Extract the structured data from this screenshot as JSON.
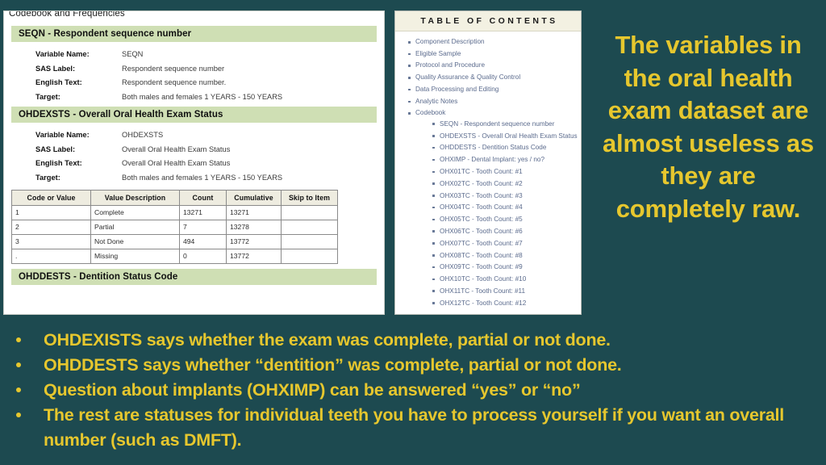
{
  "slide": {
    "background_color": "#1d4a50",
    "accent_color": "#e6c72e"
  },
  "headline": {
    "text": "The variables in the oral health exam dataset are almost useless as they are completely raw."
  },
  "screenshot": {
    "codebook_panel": {
      "title": "Codebook and Frequencies",
      "section_header_color": "#cfdfb4",
      "variables": [
        {
          "header": "SEQN - Respondent sequence number",
          "fields": [
            {
              "label": "Variable Name:",
              "value": "SEQN"
            },
            {
              "label": "SAS Label:",
              "value": "Respondent sequence number"
            },
            {
              "label": "English Text:",
              "value": "Respondent sequence number."
            },
            {
              "label": "Target:",
              "value": "Both males and females 1 YEARS - 150 YEARS"
            }
          ]
        },
        {
          "header": "OHDEXSTS - Overall Oral Health Exam Status",
          "fields": [
            {
              "label": "Variable Name:",
              "value": "OHDEXSTS"
            },
            {
              "label": "SAS Label:",
              "value": "Overall Oral Health Exam Status"
            },
            {
              "label": "English Text:",
              "value": "Overall Oral Health Exam Status"
            },
            {
              "label": "Target:",
              "value": "Both males and females 1 YEARS - 150 YEARS"
            }
          ]
        },
        {
          "header": "OHDDESTS - Dentition Status Code",
          "fields": []
        }
      ],
      "frequency_table": {
        "columns": [
          "Code or Value",
          "Value Description",
          "Count",
          "Cumulative",
          "Skip to Item"
        ],
        "rows": [
          [
            "1",
            "Complete",
            "13271",
            "13271",
            ""
          ],
          [
            "2",
            "Partial",
            "7",
            "13278",
            ""
          ],
          [
            "3",
            "Not Done",
            "494",
            "13772",
            ""
          ],
          [
            ".",
            "Missing",
            "0",
            "13772",
            ""
          ]
        ]
      }
    },
    "toc_panel": {
      "header": "TABLE OF CONTENTS",
      "link_color": "#5b6b8d",
      "items": [
        {
          "label": "Component Description"
        },
        {
          "label": "Eligible Sample"
        },
        {
          "label": "Protocol and Procedure"
        },
        {
          "label": "Quality Assurance & Quality Control"
        },
        {
          "label": "Data Processing and Editing"
        },
        {
          "label": "Analytic Notes"
        },
        {
          "label": "Codebook",
          "children": [
            {
              "label": "SEQN - Respondent sequence number"
            },
            {
              "label": "OHDEXSTS - Overall Oral Health Exam Status"
            },
            {
              "label": "OHDDESTS - Dentition Status Code"
            },
            {
              "label": "OHXIMP - Dental Implant: yes / no?"
            },
            {
              "label": "OHX01TC - Tooth Count: #1"
            },
            {
              "label": "OHX02TC - Tooth Count: #2"
            },
            {
              "label": "OHX03TC - Tooth Count: #3"
            },
            {
              "label": "OHX04TC - Tooth Count: #4"
            },
            {
              "label": "OHX05TC - Tooth Count: #5"
            },
            {
              "label": "OHX06TC - Tooth Count: #6"
            },
            {
              "label": "OHX07TC - Tooth Count: #7"
            },
            {
              "label": "OHX08TC - Tooth Count: #8"
            },
            {
              "label": "OHX09TC - Tooth Count: #9"
            },
            {
              "label": "OHX10TC - Tooth Count: #10"
            },
            {
              "label": "OHX11TC - Tooth Count: #11"
            },
            {
              "label": "OHX12TC - Tooth Count: #12"
            }
          ]
        }
      ]
    }
  },
  "bullets": [
    "OHDEXISTS says whether the exam was complete, partial or not done.",
    "OHDDESTS says whether “dentition” was complete, partial or not done.",
    "Question about implants (OHXIMP) can be answered “yes” or “no”",
    "The rest are statuses for individual teeth you have to process yourself if you want an overall number (such as DMFT)."
  ]
}
